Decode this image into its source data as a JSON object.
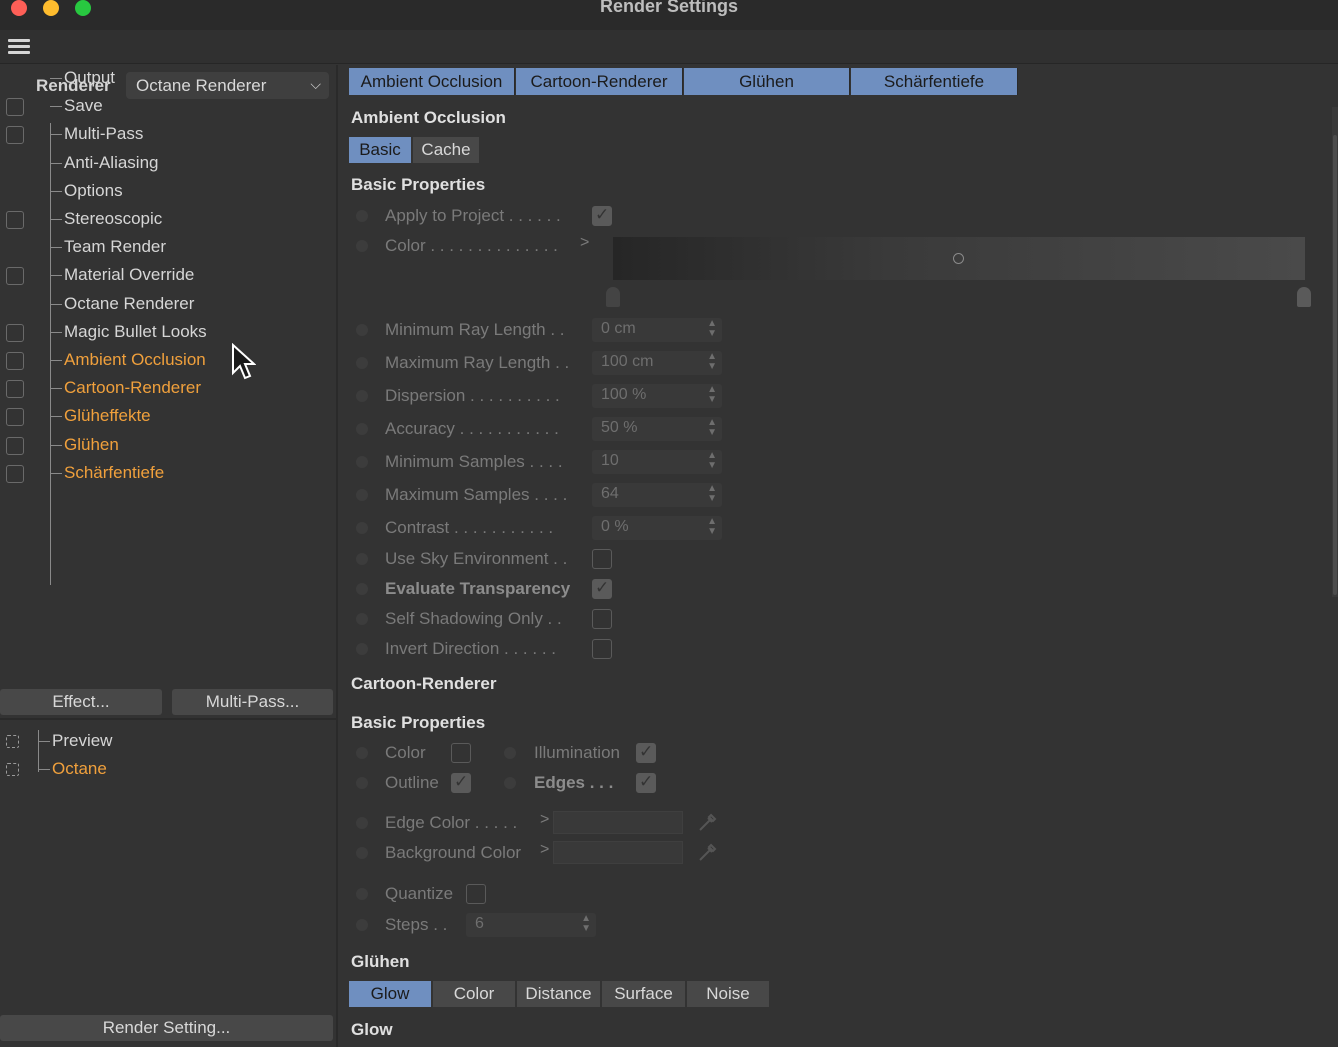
{
  "window": {
    "title": "Render Settings"
  },
  "left": {
    "renderer_label": "Renderer",
    "renderer_value": "Octane Renderer",
    "tree": [
      {
        "label": "Output",
        "checkbox": false,
        "orange": false
      },
      {
        "label": "Save",
        "checkbox": true,
        "orange": false
      },
      {
        "label": "Multi-Pass",
        "checkbox": true,
        "orange": false
      },
      {
        "label": "Anti-Aliasing",
        "checkbox": false,
        "orange": false
      },
      {
        "label": "Options",
        "checkbox": false,
        "orange": false
      },
      {
        "label": "Stereoscopic",
        "checkbox": true,
        "orange": false
      },
      {
        "label": "Team Render",
        "checkbox": false,
        "orange": false
      },
      {
        "label": "Material Override",
        "checkbox": true,
        "orange": false
      },
      {
        "label": "Octane Renderer",
        "checkbox": false,
        "orange": false
      },
      {
        "label": "Magic Bullet Looks",
        "checkbox": true,
        "orange": false
      },
      {
        "label": "Ambient Occlusion",
        "checkbox": true,
        "orange": true
      },
      {
        "label": "Cartoon-Renderer",
        "checkbox": true,
        "orange": true
      },
      {
        "label": "Glüheffekte",
        "checkbox": true,
        "orange": true
      },
      {
        "label": "Glühen",
        "checkbox": true,
        "orange": true
      },
      {
        "label": "Schärfentiefe",
        "checkbox": true,
        "orange": true
      }
    ],
    "effect_button": "Effect...",
    "multipass_button": "Multi-Pass...",
    "post": [
      {
        "label": "Preview",
        "orange": false
      },
      {
        "label": "Octane",
        "orange": true
      }
    ],
    "render_setting_button": "Render Setting..."
  },
  "right": {
    "tabs": [
      "Ambient Occlusion",
      "Cartoon-Renderer",
      "Glühen",
      "Schärfentiefe"
    ],
    "ao": {
      "title": "Ambient Occlusion",
      "subtabs": [
        "Basic",
        "Cache"
      ],
      "basic_title": "Basic Properties",
      "apply_label": "Apply to Project . . . . . .",
      "apply_checked": true,
      "color_label": "Color . . . . . . . . . . . . . .",
      "props": [
        {
          "label": "Minimum Ray Length . .",
          "value": "0 cm"
        },
        {
          "label": "Maximum Ray Length . .",
          "value": "100 cm"
        },
        {
          "label": "Dispersion . . . . . . . . . .",
          "value": "100 %"
        },
        {
          "label": "Accuracy . . . . . . . . . . .",
          "value": "50 %"
        },
        {
          "label": "Minimum Samples . . . .",
          "value": "10"
        },
        {
          "label": "Maximum Samples . . . .",
          "value": "64"
        },
        {
          "label": "Contrast . . . . . . . . . . .",
          "value": "0 %"
        }
      ],
      "checks": [
        {
          "label": "Use Sky Environment . .",
          "checked": false,
          "bold": false
        },
        {
          "label": "Evaluate Transparency",
          "checked": true,
          "bold": true
        },
        {
          "label": "Self Shadowing Only . .",
          "checked": false,
          "bold": false
        },
        {
          "label": "Invert Direction . . . . . .",
          "checked": false,
          "bold": false
        }
      ]
    },
    "cartoon": {
      "title": "Cartoon-Renderer",
      "basic_title": "Basic Properties",
      "color_label": "Color",
      "illumination_label": "Illumination",
      "outline_label": "Outline",
      "edges_label": "Edges . . .",
      "edge_color_label": "Edge Color . . . . .",
      "background_color_label": "Background Color",
      "quantize_label": "Quantize",
      "steps_label": "Steps . .",
      "steps_value": "6"
    },
    "gluhen": {
      "title": "Glühen",
      "subtabs": [
        "Glow",
        "Color",
        "Distance",
        "Surface",
        "Noise"
      ],
      "glow_title": "Glow"
    }
  }
}
